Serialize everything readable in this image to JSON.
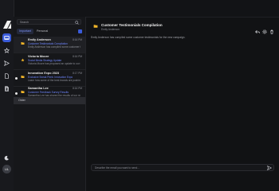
{
  "brand": {
    "logo": "A"
  },
  "rail": {
    "icons": [
      "inbox-icon",
      "star-icon",
      "send-icon",
      "file-icon",
      "file-icon",
      "trash-icon"
    ],
    "avatar_initials": "UL",
    "active_color": "#3a5bd9"
  },
  "list": {
    "search_placeholder": "Search",
    "tabs": [
      "Important",
      "Personal"
    ],
    "items": [
      {
        "name": "Emily Anderson",
        "time": "8:16 PM",
        "subject": "Customer Testimonials Compilation",
        "preview": "Emily Anderson has compiled some customer testimonials...",
        "unread": false,
        "icon": "folder-icon"
      },
      {
        "name": "Victoria Moore",
        "time": "8:16 PM",
        "subject": "Social Media Strategy Update",
        "preview": "Victoria Moore has proposed an update to our social...",
        "unread": false,
        "icon": "star-icon"
      },
      {
        "name": "Innovation Expo 2023",
        "time": "8:17 PM",
        "subject": "Exclusive Sneak Peek: Innovation Expo",
        "preview": "Learn how some of the best brands are pushing the envelope...",
        "unread": true,
        "icon": "folder-icon"
      },
      {
        "name": "Samantha Lee",
        "time": "8:16 PM",
        "subject": "Customer Feedback Survey Results",
        "preview": "Samantha Lee has shared the results of our recent...",
        "unread": true,
        "icon": "folder-icon"
      }
    ],
    "older_label": "Older"
  },
  "detail": {
    "title": "Customer Testimonials Compilation",
    "from": "Emily Anderson",
    "body": "Emily Anderson has compiled some customer testimonials for the new campaign.",
    "reply_placeholder": "Describe the email you want to send..."
  }
}
